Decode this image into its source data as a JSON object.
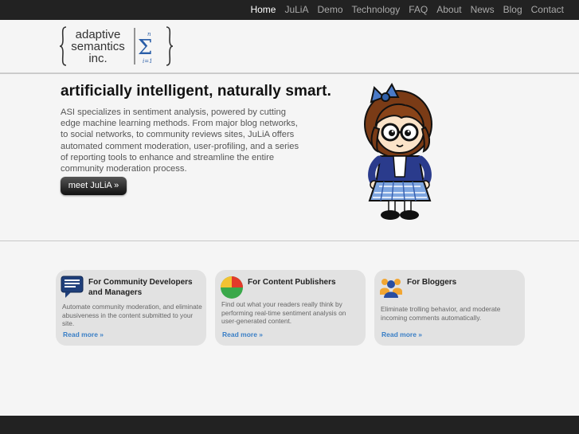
{
  "nav": {
    "items": [
      {
        "label": "Home",
        "active": true
      },
      {
        "label": "JuLiA",
        "active": false
      },
      {
        "label": "Demo",
        "active": false
      },
      {
        "label": "Technology",
        "active": false
      },
      {
        "label": "FAQ",
        "active": false
      },
      {
        "label": "About",
        "active": false
      },
      {
        "label": "News",
        "active": false
      },
      {
        "label": "Blog",
        "active": false
      },
      {
        "label": "Contact",
        "active": false
      }
    ]
  },
  "logo": {
    "line1": "adaptive",
    "line2": "semantics",
    "line3": "inc.",
    "sum_top": "n",
    "sum_symbol": "Σ",
    "sum_bottom": "i=1"
  },
  "hero": {
    "title": "artificially intelligent, naturally smart.",
    "text": "ASI specializes in sentiment analysis, powered by cutting edge machine learning methods. From major blog networks, to social networks, to community reviews sites, JuLiA offers automated comment moderation, user-profiling, and a series of reporting tools to enhance and streamline the entire community moderation process.",
    "button": "meet JuLiA »"
  },
  "cards": [
    {
      "icon": "speech-bubble-icon",
      "title": "For Community Developers and Managers",
      "desc": "Automate community moderation, and eliminate abusiveness in the content submitted to your site.",
      "more": "Read more »"
    },
    {
      "icon": "pie-chart-icon",
      "title": "For Content Publishers",
      "desc": "Find out what your readers really think by performing real-time sentiment analysis on user-generated content.",
      "more": "Read more »"
    },
    {
      "icon": "people-group-icon",
      "title": "For Bloggers",
      "desc": "Eliminate trolling behavior, and moderate incoming comments automatically.",
      "more": "Read more »"
    }
  ],
  "colors": {
    "topbar": "#222222",
    "background": "#f5f5f5",
    "card": "#e2e2e2",
    "link": "#3a7fc6",
    "sum_blue": "#2a5ea8"
  }
}
